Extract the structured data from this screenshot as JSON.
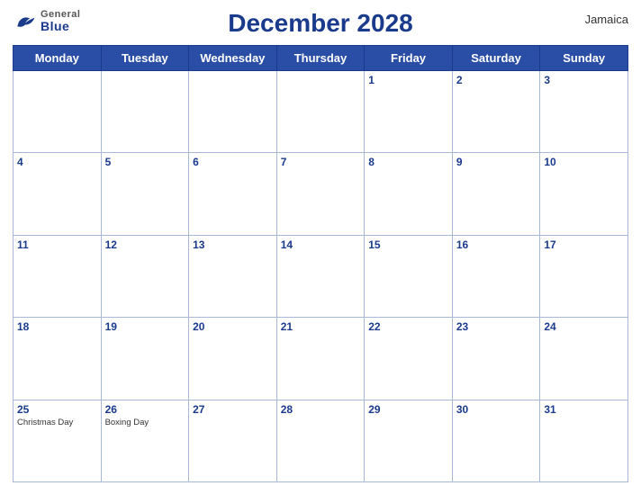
{
  "header": {
    "title": "December 2028",
    "country": "Jamaica",
    "logo": {
      "general": "General",
      "blue": "Blue"
    }
  },
  "weekdays": [
    "Monday",
    "Tuesday",
    "Wednesday",
    "Thursday",
    "Friday",
    "Saturday",
    "Sunday"
  ],
  "weeks": [
    [
      {
        "day": null
      },
      {
        "day": null
      },
      {
        "day": null
      },
      {
        "day": null
      },
      {
        "day": "1"
      },
      {
        "day": "2"
      },
      {
        "day": "3"
      }
    ],
    [
      {
        "day": "4"
      },
      {
        "day": "5"
      },
      {
        "day": "6"
      },
      {
        "day": "7"
      },
      {
        "day": "8"
      },
      {
        "day": "9"
      },
      {
        "day": "10"
      }
    ],
    [
      {
        "day": "11"
      },
      {
        "day": "12"
      },
      {
        "day": "13"
      },
      {
        "day": "14"
      },
      {
        "day": "15"
      },
      {
        "day": "16"
      },
      {
        "day": "17"
      }
    ],
    [
      {
        "day": "18"
      },
      {
        "day": "19"
      },
      {
        "day": "20"
      },
      {
        "day": "21"
      },
      {
        "day": "22"
      },
      {
        "day": "23"
      },
      {
        "day": "24"
      }
    ],
    [
      {
        "day": "25",
        "holiday": "Christmas Day"
      },
      {
        "day": "26",
        "holiday": "Boxing Day"
      },
      {
        "day": "27"
      },
      {
        "day": "28"
      },
      {
        "day": "29"
      },
      {
        "day": "30"
      },
      {
        "day": "31"
      }
    ]
  ],
  "colors": {
    "header_bg": "#2a4ea6",
    "header_text": "#ffffff",
    "title_color": "#1a3a8c",
    "day_number_color": "#1a3a8c",
    "border_color": "#aab8d8"
  }
}
